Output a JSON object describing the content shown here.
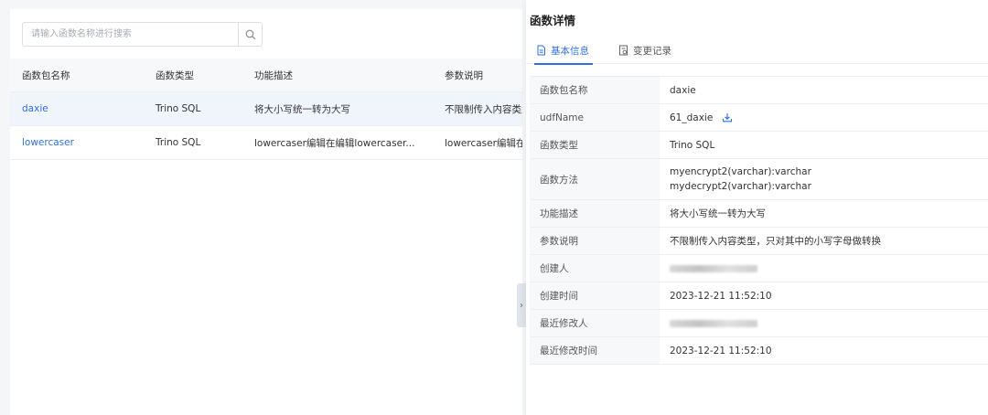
{
  "search": {
    "placeholder": "请输入函数名称进行搜索"
  },
  "table": {
    "headers": [
      "函数包名称",
      "函数类型",
      "功能描述",
      "参数说明"
    ],
    "rows": [
      {
        "name": "daxie",
        "type": "Trino SQL",
        "desc": "将大小写统一转为大写",
        "params": "不限制传入内容类型"
      },
      {
        "name": "lowercaser",
        "type": "Trino SQL",
        "desc": "lowercaser编辑在编辑lowercaser...",
        "params": "lowercaser编辑在"
      }
    ]
  },
  "detail": {
    "title": "函数详情",
    "tabs": [
      "基本信息",
      "变更记录"
    ],
    "fields": [
      {
        "key": "函数包名称",
        "value": "daxie"
      },
      {
        "key": "udfName",
        "value": "61_daxie"
      },
      {
        "key": "函数类型",
        "value": "Trino SQL"
      },
      {
        "key": "函数方法",
        "lines": [
          "myencrypt2(varchar):varchar",
          "mydecrypt2(varchar):varchar"
        ]
      },
      {
        "key": "功能描述",
        "value": "将大小写统一转为大写"
      },
      {
        "key": "参数说明",
        "value": "不限制传入内容类型，只对其中的小写字母做转换"
      },
      {
        "key": "创建人",
        "value": ""
      },
      {
        "key": "创建时间",
        "value": "2023-12-21 11:52:10"
      },
      {
        "key": "最近修改人",
        "value": ""
      },
      {
        "key": "最近修改时间",
        "value": "2023-12-21 11:52:10"
      }
    ]
  },
  "colors": {
    "accent": "#2f6fde"
  }
}
